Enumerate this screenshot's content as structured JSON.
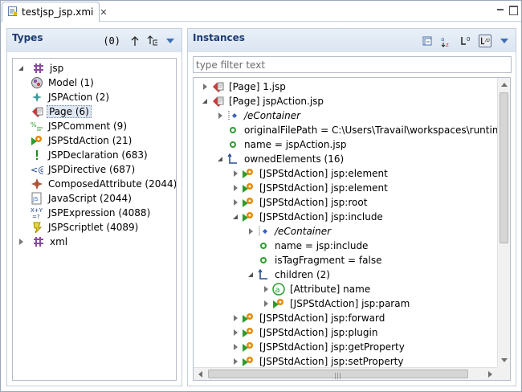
{
  "editor": {
    "tab_title": "testjsp_jsp.xmi",
    "close_symbol": "✕"
  },
  "types": {
    "title": "Types",
    "count": "(0)",
    "tree": [
      {
        "label": "jsp",
        "icon": "package-icon",
        "expanded": true,
        "level": 0
      },
      {
        "label": "Model (1)",
        "icon": "model-icon",
        "level": 1
      },
      {
        "label": "JSPAction (2)",
        "icon": "jspaction-icon",
        "level": 1
      },
      {
        "label": "Page (6)",
        "icon": "page-icon",
        "level": 1,
        "selected": true
      },
      {
        "label": "JSPComment (9)",
        "icon": "jspcomment-icon",
        "level": 1
      },
      {
        "label": "JSPStdAction (21)",
        "icon": "jspstdaction-icon",
        "level": 1
      },
      {
        "label": "JSPDeclaration (683)",
        "icon": "jspdeclaration-icon",
        "level": 1
      },
      {
        "label": "JSPDirective (687)",
        "icon": "jspdirective-icon",
        "level": 1
      },
      {
        "label": "ComposedAttribute (2044)",
        "icon": "composedattribute-icon",
        "level": 1
      },
      {
        "label": "JavaScript (2044)",
        "icon": "javascript-icon",
        "level": 1
      },
      {
        "label": "JSPExpression (4088)",
        "icon": "jspexpression-icon",
        "level": 1
      },
      {
        "label": "JSPScriptlet (4089)",
        "icon": "jspscriptlet-icon",
        "level": 1
      },
      {
        "label": "xml",
        "icon": "package-icon",
        "expanded": false,
        "level": 0
      }
    ]
  },
  "instances": {
    "title": "Instances",
    "filter_placeholder": "type filter text",
    "tree": [
      {
        "label": "[Page] 1.jsp",
        "icon": "page-icon",
        "level": 0,
        "twisty": "collapsed"
      },
      {
        "label": "[Page] jspAction.jsp",
        "icon": "page-icon",
        "level": 0,
        "twisty": "expanded"
      },
      {
        "label": "/eContainer",
        "icon": "econtainer-icon",
        "level": 1,
        "twisty": "collapsed",
        "italic": true
      },
      {
        "label": "originalFilePath = C:\\Users\\Travail\\workspaces\\runtime-Mo",
        "icon": "attribute-icon",
        "level": 1,
        "twisty": "none"
      },
      {
        "label": "name = jspAction.jsp",
        "icon": "attribute-icon",
        "level": 1,
        "twisty": "none"
      },
      {
        "label": "ownedElements (16)",
        "icon": "reference-icon",
        "level": 1,
        "twisty": "expanded"
      },
      {
        "label": "[JSPStdAction] jsp:element",
        "icon": "jspstdaction-icon",
        "level": 2,
        "twisty": "collapsed"
      },
      {
        "label": "[JSPStdAction] jsp:element",
        "icon": "jspstdaction-icon",
        "level": 2,
        "twisty": "collapsed"
      },
      {
        "label": "[JSPStdAction] jsp:root",
        "icon": "jspstdaction-icon",
        "level": 2,
        "twisty": "collapsed"
      },
      {
        "label": "[JSPStdAction] jsp:include",
        "icon": "jspstdaction-icon",
        "level": 2,
        "twisty": "expanded"
      },
      {
        "label": "/eContainer",
        "icon": "econtainer-icon",
        "level": 3,
        "twisty": "collapsed",
        "italic": true
      },
      {
        "label": "name = jsp:include",
        "icon": "attribute-icon",
        "level": 3,
        "twisty": "none"
      },
      {
        "label": "isTagFragment = false",
        "icon": "attribute-icon",
        "level": 3,
        "twisty": "none"
      },
      {
        "label": "children (2)",
        "icon": "reference-icon",
        "level": 3,
        "twisty": "expanded"
      },
      {
        "label": "[Attribute] name",
        "icon": "at-icon",
        "level": 4,
        "twisty": "collapsed"
      },
      {
        "label": "[JSPStdAction] jsp:param",
        "icon": "jspstdaction-icon",
        "level": 4,
        "twisty": "collapsed"
      },
      {
        "label": "[JSPStdAction] jsp:forward",
        "icon": "jspstdaction-icon",
        "level": 2,
        "twisty": "collapsed"
      },
      {
        "label": "[JSPStdAction] jsp:plugin",
        "icon": "jspstdaction-icon",
        "level": 2,
        "twisty": "collapsed"
      },
      {
        "label": "[JSPStdAction] jsp:getProperty",
        "icon": "jspstdaction-icon",
        "level": 2,
        "twisty": "collapsed"
      },
      {
        "label": "[JSPStdAction] jsp:setProperty",
        "icon": "jspstdaction-icon",
        "level": 2,
        "twisty": "collapsed"
      }
    ]
  },
  "colors": {
    "header_title": "#1c3c73",
    "attribute_green": "#2e9c2e",
    "page_red": "#c63b3b",
    "package_purple": "#8a4aa0"
  }
}
